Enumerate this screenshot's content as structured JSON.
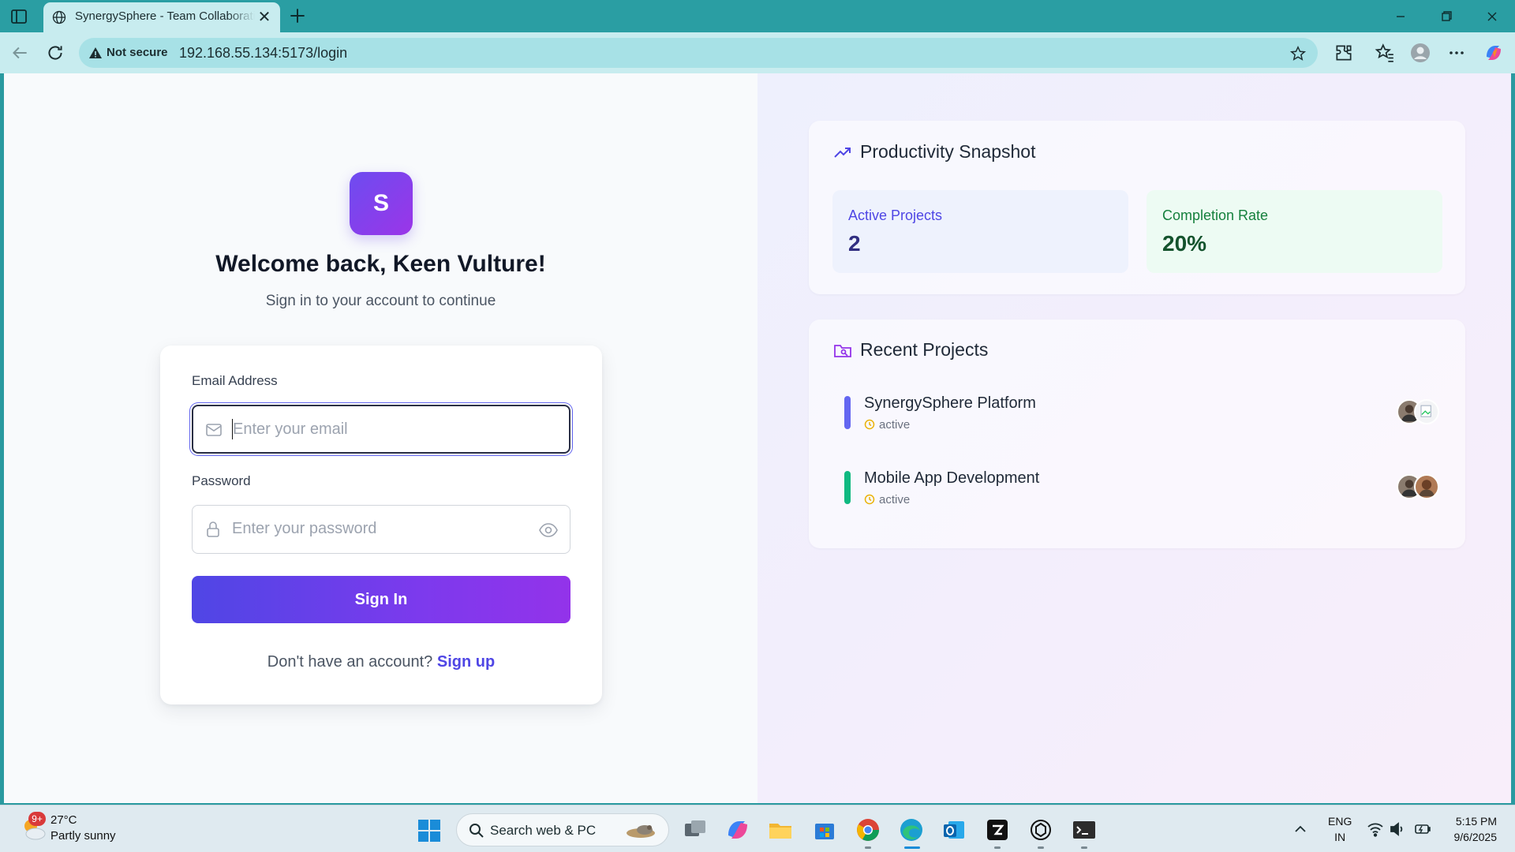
{
  "browser": {
    "tab_title": "SynergySphere - Team Collaboration",
    "security_label": "Not secure",
    "url": "192.168.55.134:5173/login"
  },
  "login": {
    "logo_letter": "S",
    "welcome": "Welcome back, Keen Vulture!",
    "subtitle": "Sign in to your account to continue",
    "email_label": "Email Address",
    "email_placeholder": "Enter your email",
    "password_label": "Password",
    "password_placeholder": "Enter your password",
    "signin_label": "Sign In",
    "signup_prompt": "Don't have an account?",
    "signup_link": "Sign up"
  },
  "snapshot": {
    "title": "Productivity Snapshot",
    "stats": [
      {
        "label": "Active Projects",
        "value": "2"
      },
      {
        "label": "Completion Rate",
        "value": "20%"
      }
    ]
  },
  "recent": {
    "title": "Recent Projects",
    "projects": [
      {
        "name": "SynergySphere Platform",
        "status": "active",
        "color": "#6366f1"
      },
      {
        "name": "Mobile App Development",
        "status": "active",
        "color": "#10b981"
      }
    ]
  },
  "taskbar": {
    "weather_badge": "9+",
    "temperature": "27°C",
    "weather_desc": "Partly sunny",
    "search_label": "Search web & PC",
    "lang_line1": "ENG",
    "lang_line2": "IN",
    "time": "5:15 PM",
    "date": "9/6/2025"
  },
  "colors": {
    "accent": "#4f46e5",
    "brand_gradient_start": "#6d4cf0",
    "brand_gradient_end": "#9b35e8",
    "chrome": "#2a9ea3"
  }
}
